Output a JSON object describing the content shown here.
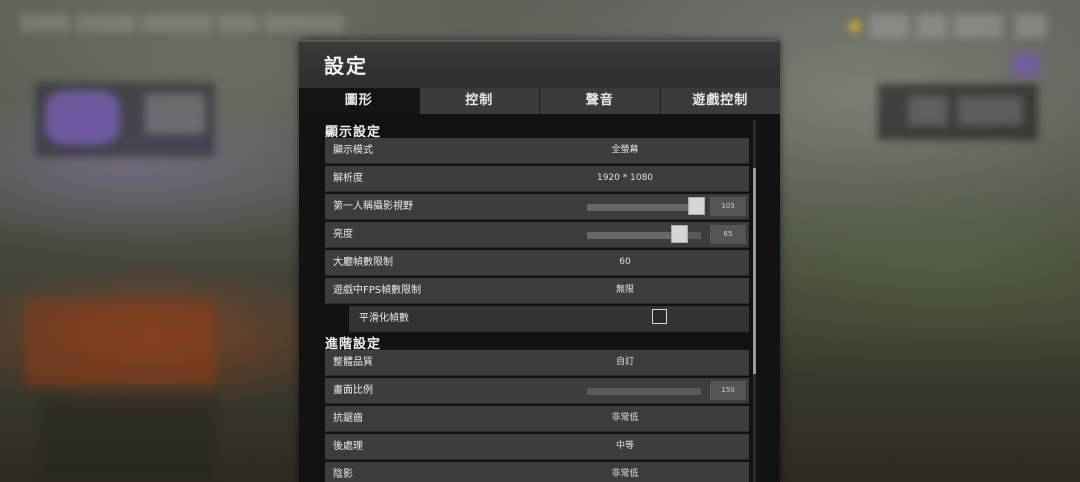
{
  "dialog": {
    "title": "設定",
    "tabs": [
      {
        "label": "圖形",
        "active": true
      },
      {
        "label": "控制",
        "active": false
      },
      {
        "label": "聲音",
        "active": false
      },
      {
        "label": "遊戲控制",
        "active": false
      }
    ]
  },
  "display_section": {
    "heading": "顯示設定",
    "display_mode": {
      "label": "顯示模式",
      "value": "全螢幕"
    },
    "resolution": {
      "label": "解析度",
      "value": "1920 * 1080"
    },
    "fov": {
      "label": "第一人稱攝影視野",
      "value": "103",
      "slider_fraction": 0.96
    },
    "brightness": {
      "label": "亮度",
      "value": "65",
      "slider_fraction": 0.81
    },
    "lobby_fps": {
      "label": "大廳幀數限制",
      "value": "60"
    },
    "ingame_fps": {
      "label": "遊戲中FPS幀數限制",
      "value": "無限"
    },
    "smooth_frame": {
      "label": "平滑化幀數",
      "checked": false
    }
  },
  "advanced_section": {
    "heading": "進階設定",
    "overall_quality": {
      "label": "整體品質",
      "value": "自訂"
    },
    "screen_scale": {
      "label": "畫面比例",
      "value": "150"
    },
    "anti_aliasing": {
      "label": "抗鋸齒",
      "value": "非常低"
    },
    "post_processing": {
      "label": "後處理",
      "value": "中等"
    },
    "shadows": {
      "label": "陰影",
      "value": "非常低"
    }
  },
  "colors": {
    "panel": "#3d3d3d",
    "tab_active": "#141414",
    "tab_inactive": "#3b3b3b",
    "coin": "#e0b828"
  }
}
